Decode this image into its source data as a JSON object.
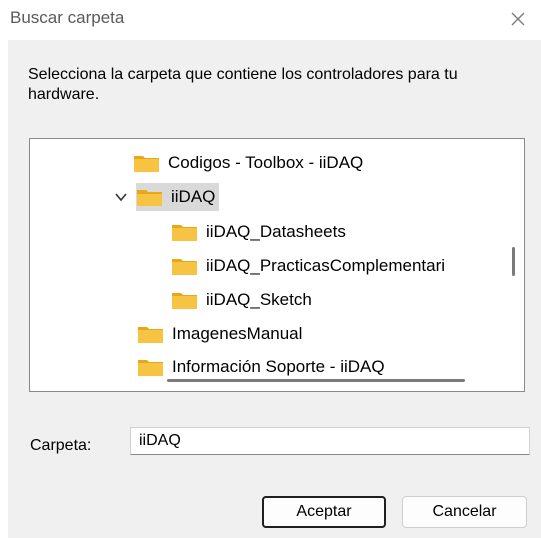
{
  "window": {
    "title": "Buscar carpeta",
    "close_glyph": "✕"
  },
  "description": "Selecciona la carpeta que contiene los controladores para tu hardware.",
  "tree": {
    "items": [
      {
        "label": "Codigos - Toolbox - iiDAQ",
        "icon": "folder-icon"
      },
      {
        "label": "iiDAQ",
        "icon": "folder-icon",
        "expanded": true,
        "selected": true
      },
      {
        "label": "iiDAQ_Datasheets",
        "icon": "folder-icon"
      },
      {
        "label": "iiDAQ_PracticasComplementari",
        "icon": "folder-icon"
      },
      {
        "label": "iiDAQ_Sketch",
        "icon": "folder-icon"
      },
      {
        "label": "ImagenesManual",
        "icon": "folder-icon"
      },
      {
        "label": "Información Soporte - iiDAQ",
        "icon": "folder-icon"
      }
    ]
  },
  "folder_label": "Carpeta:",
  "folder_value": "iiDAQ",
  "buttons": {
    "ok": "Aceptar",
    "cancel": "Cancelar"
  },
  "colors": {
    "folder": "#f6c343",
    "folder_dark": "#e6a817",
    "selection": "#d9d9d9",
    "dialog_bg": "#f0f0f0"
  }
}
